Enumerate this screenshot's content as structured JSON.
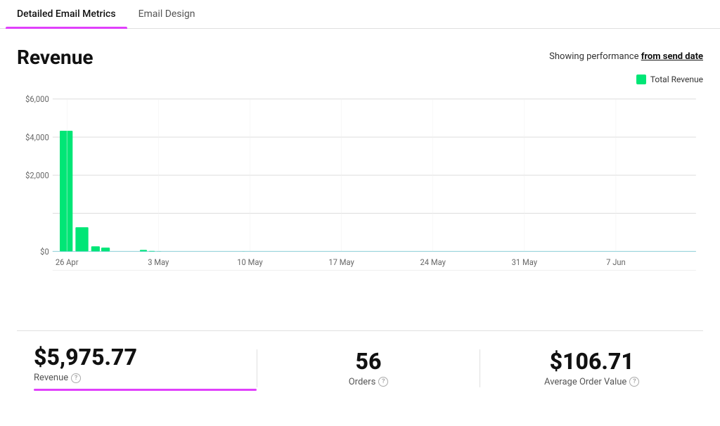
{
  "tabs": [
    {
      "id": "detailed-email-metrics",
      "label": "Detailed Email Metrics",
      "active": true
    },
    {
      "id": "email-design",
      "label": "Email Design",
      "active": false
    }
  ],
  "header": {
    "title": "Revenue",
    "performance_text": "Showing performance ",
    "performance_link": "from send date"
  },
  "legend": {
    "label": "Total Revenue"
  },
  "chart": {
    "y_labels": [
      "$6,000",
      "$4,000",
      "$2,000",
      "$0"
    ],
    "x_labels": [
      "26 Apr",
      "3 May",
      "10 May",
      "17 May",
      "24 May",
      "31 May",
      "7 Jun"
    ],
    "bars": [
      {
        "date": "26 Apr",
        "value": 4750
      },
      {
        "date": "26 Apr+1",
        "value": 950
      },
      {
        "date": "26 Apr+2",
        "value": 200
      },
      {
        "date": "26 Apr+3",
        "value": 150
      },
      {
        "date": "3 May-1",
        "value": 60
      },
      {
        "date": "3 May",
        "value": 20
      },
      {
        "date": "3 May+1",
        "value": 5
      },
      {
        "date": "10 May",
        "value": 2
      },
      {
        "date": "17 May",
        "value": 1
      },
      {
        "date": "24 May",
        "value": 1
      },
      {
        "date": "31 May",
        "value": 0
      }
    ],
    "max_value": 6000
  },
  "stats": [
    {
      "id": "revenue",
      "value": "$5,975.77",
      "label": "Revenue",
      "has_underline": true
    },
    {
      "id": "orders",
      "value": "56",
      "label": "Orders",
      "has_underline": false
    },
    {
      "id": "avg-order-value",
      "value": "$106.71",
      "label": "Average Order Value",
      "has_underline": false
    }
  ]
}
